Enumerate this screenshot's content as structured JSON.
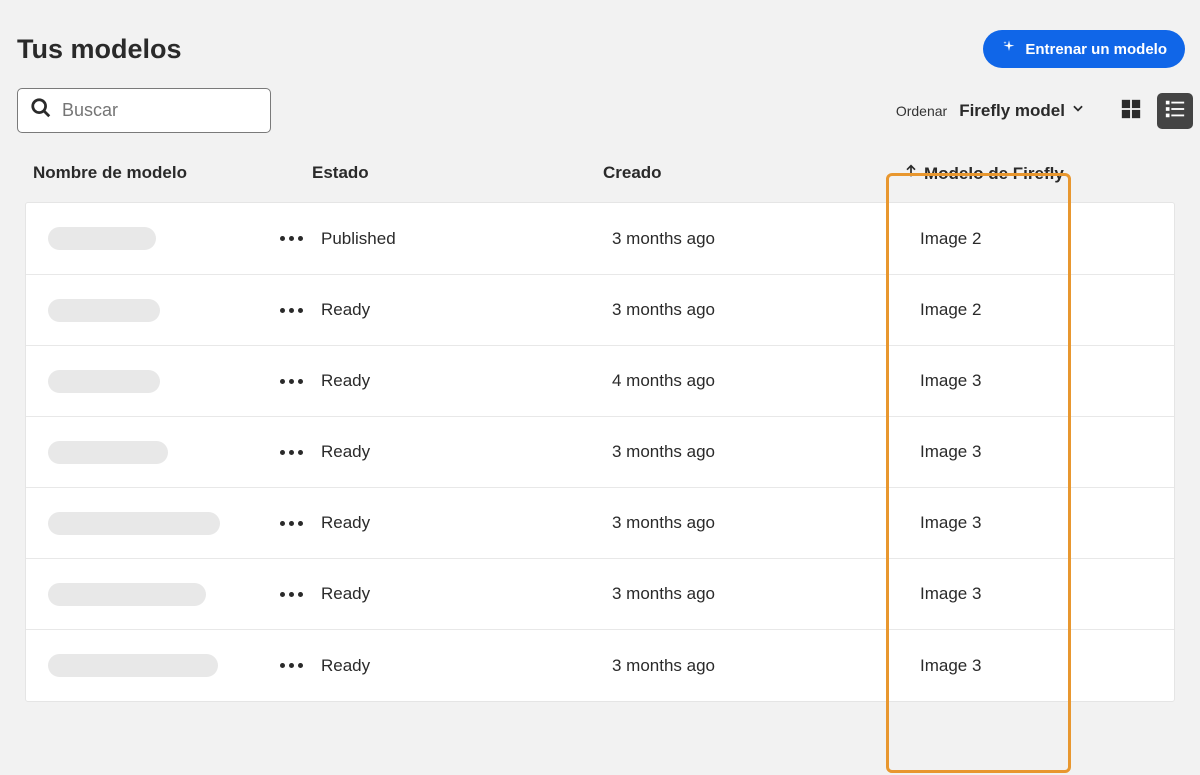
{
  "header": {
    "title": "Tus modelos",
    "train_button": "Entrenar un modelo"
  },
  "search": {
    "placeholder": "Buscar"
  },
  "sort": {
    "label": "Ordenar",
    "value": "Firefly model"
  },
  "columns": {
    "name": "Nombre de modelo",
    "status": "Estado",
    "created": "Creado",
    "firefly": "Modelo de Firefly"
  },
  "rows": [
    {
      "placeholder_width": 108,
      "status": "Published",
      "created": "3 months ago",
      "firefly": "Image 2"
    },
    {
      "placeholder_width": 112,
      "status": "Ready",
      "created": "3 months ago",
      "firefly": "Image 2"
    },
    {
      "placeholder_width": 112,
      "status": "Ready",
      "created": "4 months ago",
      "firefly": "Image 3"
    },
    {
      "placeholder_width": 120,
      "status": "Ready",
      "created": "3 months ago",
      "firefly": "Image 3"
    },
    {
      "placeholder_width": 172,
      "status": "Ready",
      "created": "3 months ago",
      "firefly": "Image 3"
    },
    {
      "placeholder_width": 158,
      "status": "Ready",
      "created": "3 months ago",
      "firefly": "Image 3"
    },
    {
      "placeholder_width": 170,
      "status": "Ready",
      "created": "3 months ago",
      "firefly": "Image 3"
    }
  ]
}
